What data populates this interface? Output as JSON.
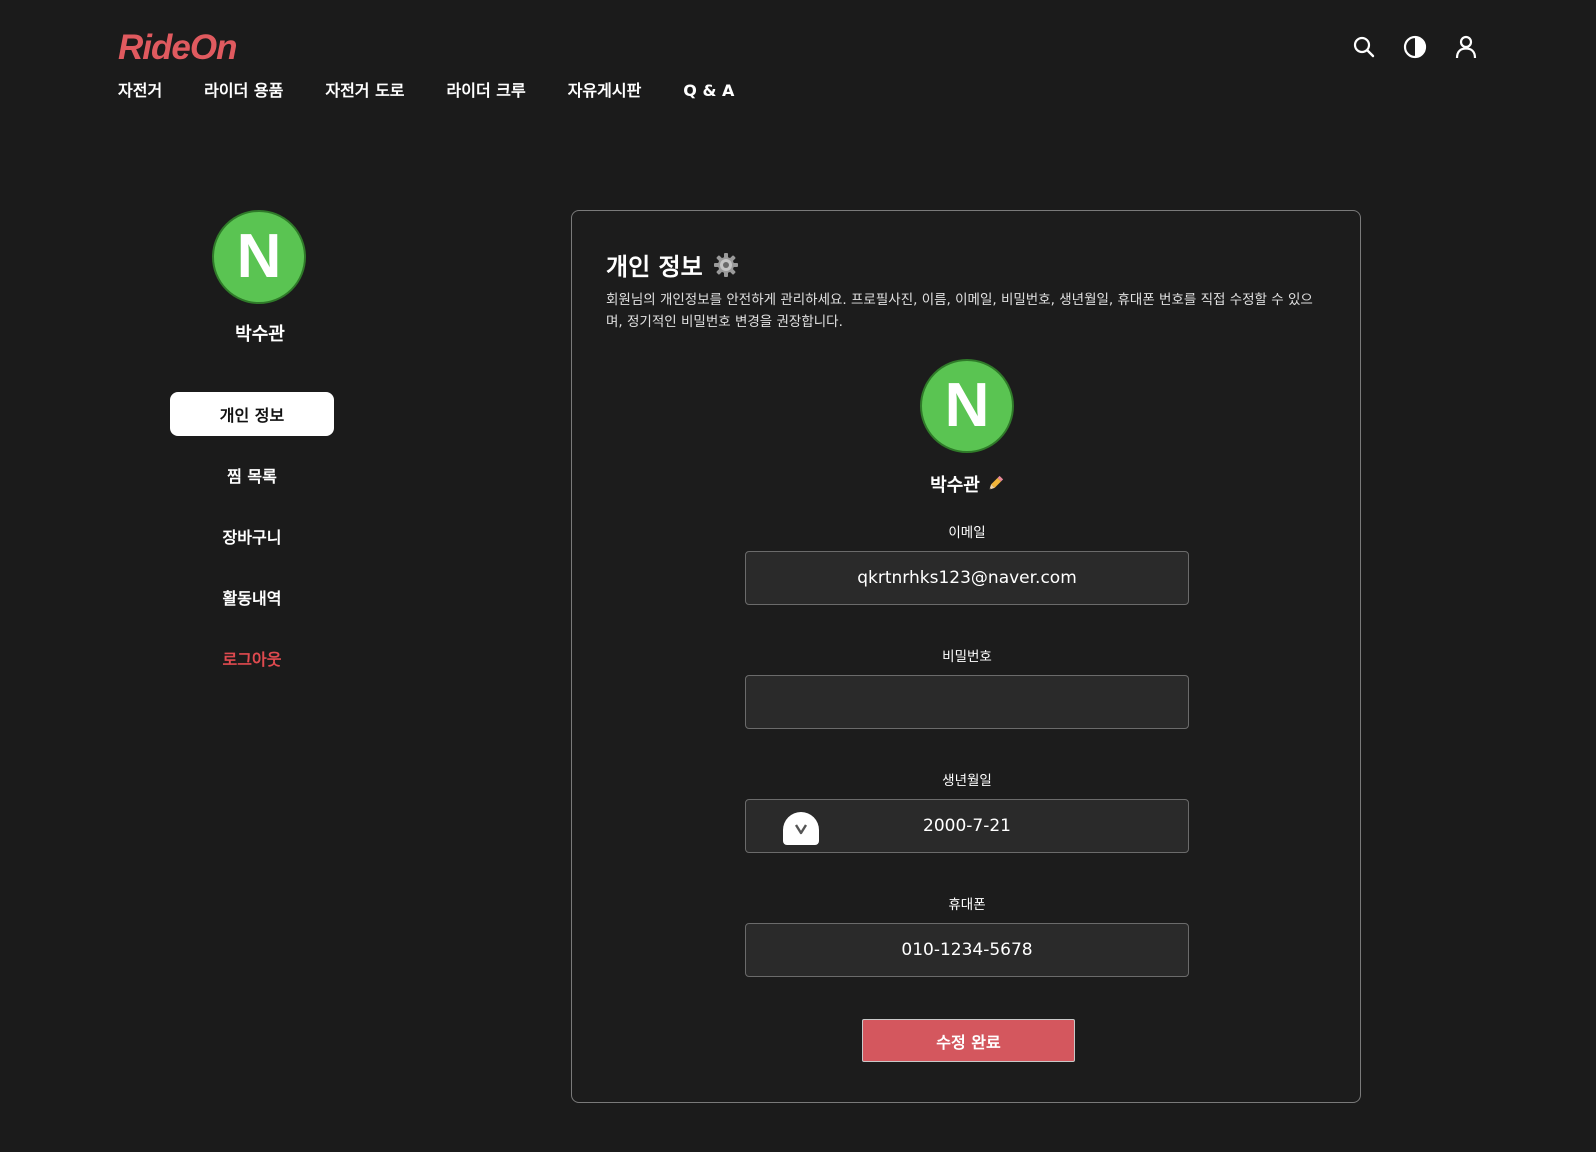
{
  "header": {
    "logo": "RideOn",
    "nav": [
      "자전거",
      "라이더 용품",
      "자전거 도로",
      "라이더 크루",
      "자유게시판",
      "Q & A"
    ],
    "icons": [
      "search-icon",
      "contrast-icon",
      "user-icon"
    ]
  },
  "sidebar": {
    "avatar_letter": "N",
    "user_name": "박수관",
    "menu": [
      "개인 정보",
      "찜 목록",
      "장바구니",
      "활동내역"
    ],
    "logout": "로그아웃"
  },
  "main": {
    "title": "개인 정보",
    "description": "회원님의 개인정보를 안전하게 관리하세요. 프로필사진, 이름, 이메일, 비밀번호, 생년월일, 휴대폰 번호를 직접 수정할 수 있으며, 정기적인 비밀번호 변경을 권장합니다.",
    "avatar_letter": "N",
    "user_name": "박수관",
    "fields": {
      "email": {
        "label": "이메일",
        "value": "qkrtnrhks123@naver.com"
      },
      "password": {
        "label": "비밀번호",
        "value": ""
      },
      "birth": {
        "label": "생년월일",
        "value": "2000-7-21"
      },
      "phone": {
        "label": "휴대폰",
        "value": "010-1234-5678"
      }
    },
    "submit_label": "수정 완료"
  },
  "colors": {
    "background": "#1b1b1b",
    "brand": "#e05a5f",
    "avatar_green": "#5ac452",
    "logout_red": "#e04a4f",
    "submit_red": "#d4575e"
  }
}
